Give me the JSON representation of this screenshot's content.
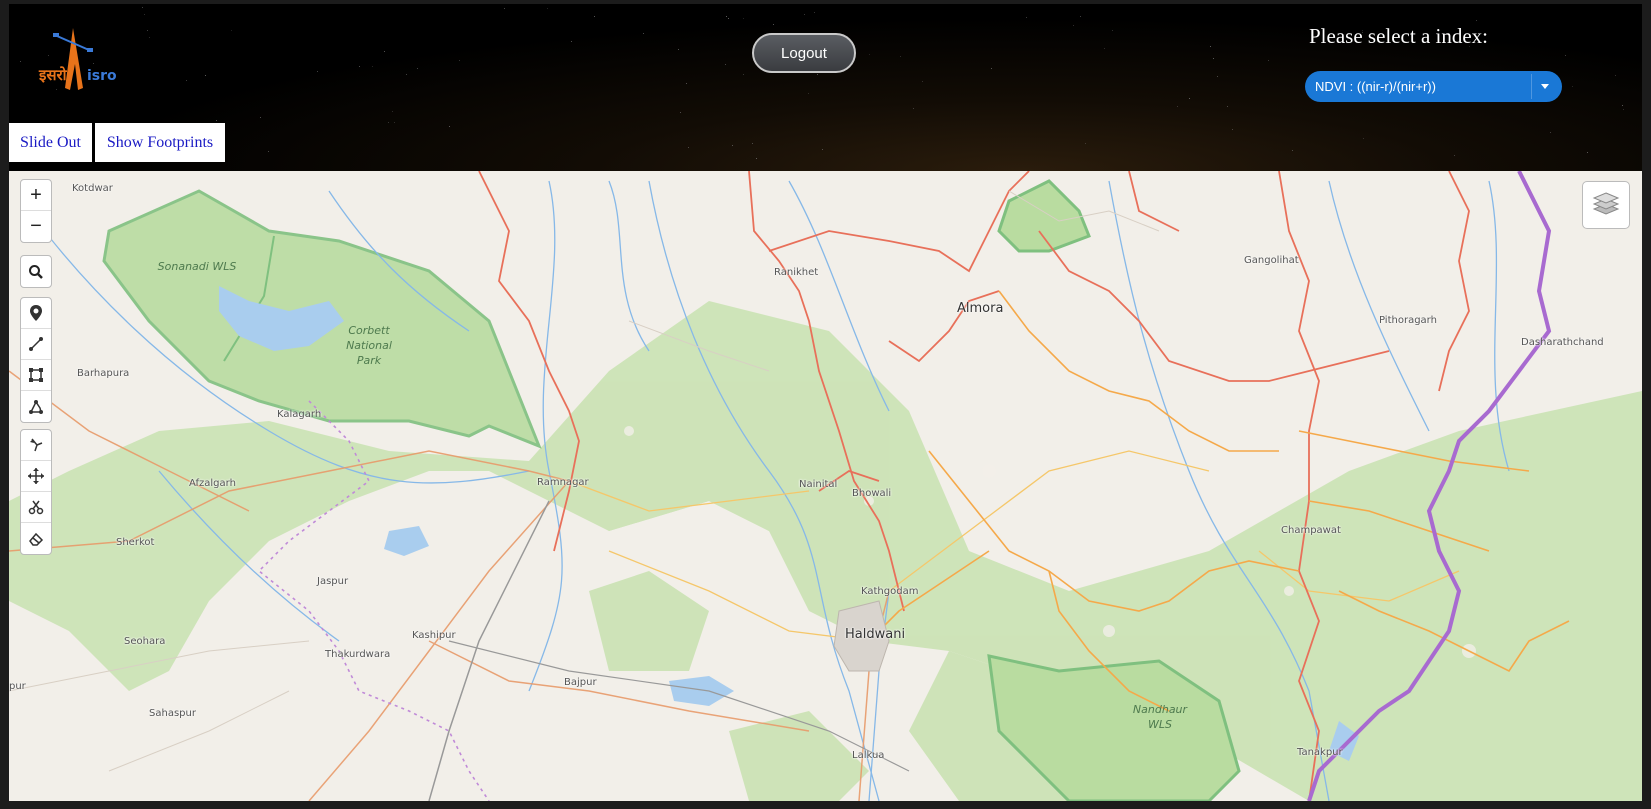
{
  "header": {
    "logo_icon": "isro-logo",
    "logout_label": "Logout",
    "index_prompt": "Please select a index:",
    "index_selected": "NDVI : ((nir-r)/(nir+r))",
    "slide_out_label": "Slide Out",
    "show_footprints_label": "Show Footprints"
  },
  "map": {
    "places": [
      {
        "id": "kotdwar",
        "label": "Kotdwar"
      },
      {
        "id": "barhapura",
        "label": "Barhapura"
      },
      {
        "id": "kalagarh",
        "label": "Kalagarh"
      },
      {
        "id": "afzalgarh",
        "label": "Afzalgarh"
      },
      {
        "id": "sherkot",
        "label": "Sherkot"
      },
      {
        "id": "seohara",
        "label": "Seohara"
      },
      {
        "id": "sahaspur",
        "label": "Sahaspur"
      },
      {
        "id": "pur",
        "label": "pur"
      },
      {
        "id": "jaspur",
        "label": "Jaspur"
      },
      {
        "id": "thakurdwara",
        "label": "Thakurdwara"
      },
      {
        "id": "kashipur",
        "label": "Kashipur"
      },
      {
        "id": "bajpur",
        "label": "Bajpur"
      },
      {
        "id": "ramnagar",
        "label": "Ramnagar"
      },
      {
        "id": "ranikhet",
        "label": "Ranikhet"
      },
      {
        "id": "almora",
        "label": "Almora"
      },
      {
        "id": "nainital",
        "label": "Nainital"
      },
      {
        "id": "bhowali",
        "label": "Bhowali"
      },
      {
        "id": "kathgodam",
        "label": "Kathgodam"
      },
      {
        "id": "haldwani",
        "label": "Haldwani"
      },
      {
        "id": "lalkua",
        "label": "Lalkua"
      },
      {
        "id": "gangolihat",
        "label": "Gangolihat"
      },
      {
        "id": "pithoragarh",
        "label": "Pithoragarh"
      },
      {
        "id": "dasharathchand",
        "label": "Dasharathchand"
      },
      {
        "id": "champawat",
        "label": "Champawat"
      },
      {
        "id": "tanakpur",
        "label": "Tanakpur"
      }
    ],
    "parks": [
      {
        "id": "sonanadi",
        "label": "Sonanadi WLS"
      },
      {
        "id": "corbett",
        "label": "Corbett National Park"
      },
      {
        "id": "nandhaur",
        "label": "Nandhaur WLS"
      }
    ],
    "zoom_in_label": "+",
    "zoom_out_label": "−",
    "tools": [
      "search-icon",
      "marker-icon",
      "polyline-icon",
      "rectangle-icon",
      "polygon-icon",
      "cut-icon",
      "drag-icon",
      "scissors-icon",
      "eraser-icon"
    ],
    "layers_icon": "layers-icon"
  },
  "colors": {
    "header_bg": "#000000",
    "select_bg": "#1a78d6",
    "button_text": "#1a1ac4",
    "map_land": "#f2efe9",
    "forest": "#c8e2b0",
    "park_border": "#7fc07f",
    "state_border": "#e8705a",
    "district_border": "#f5a94a",
    "intl_border": "#a86ad0",
    "river": "#86b8e8"
  }
}
